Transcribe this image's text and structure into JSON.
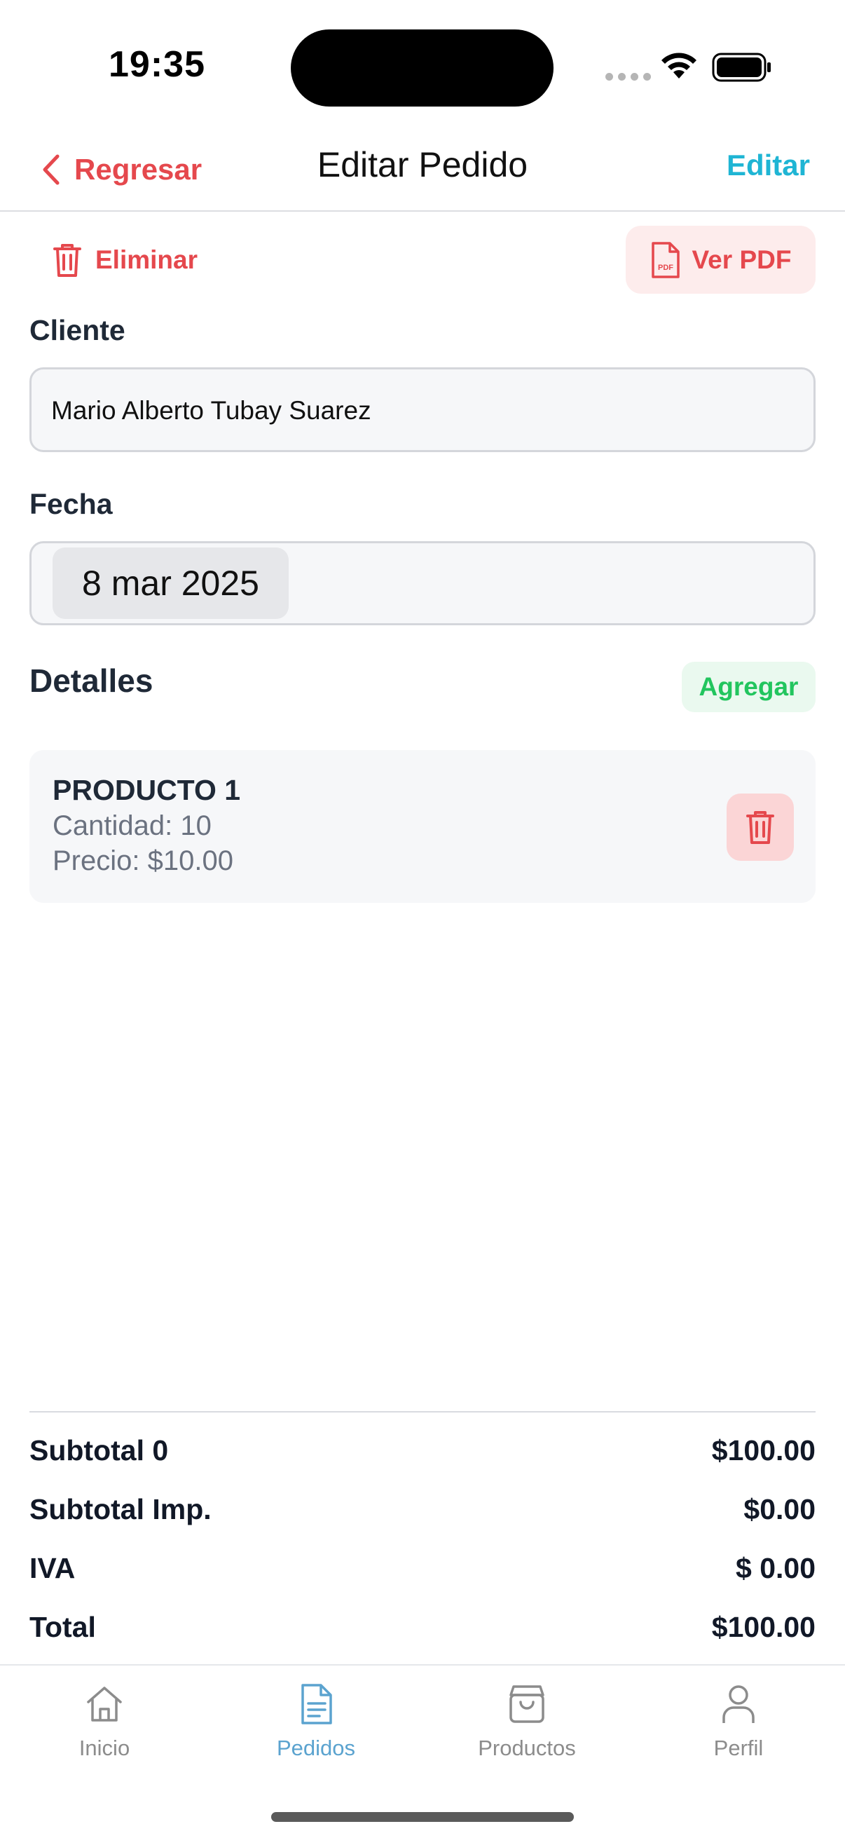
{
  "status_bar": {
    "time": "19:35"
  },
  "header": {
    "back_label": "Regresar",
    "title": "Editar Pedido",
    "edit_label": "Editar"
  },
  "actions": {
    "delete_label": "Eliminar",
    "pdf_label": "Ver PDF"
  },
  "form": {
    "client_label": "Cliente",
    "client_value": "Mario Alberto Tubay Suarez",
    "date_label": "Fecha",
    "date_value": "8 mar 2025"
  },
  "details": {
    "title": "Detalles",
    "add_label": "Agregar",
    "items": [
      {
        "name": "PRODUCTO 1",
        "quantity": "Cantidad: 10",
        "price": "Precio: $10.00"
      }
    ]
  },
  "totals": {
    "rows": [
      {
        "label": "Subtotal 0",
        "value": "$100.00"
      },
      {
        "label": "Subtotal Imp.",
        "value": "$0.00"
      },
      {
        "label": "IVA",
        "value": "$ 0.00"
      },
      {
        "label": "Total",
        "value": "$100.00"
      }
    ]
  },
  "tabbar": {
    "active": "Pedidos",
    "tabs": [
      {
        "label": "Inicio",
        "icon": "home-icon"
      },
      {
        "label": "Pedidos",
        "icon": "document-icon"
      },
      {
        "label": "Productos",
        "icon": "shopping-bag-icon"
      },
      {
        "label": "Perfil",
        "icon": "user-icon"
      }
    ]
  },
  "colors": {
    "danger": "#e5484d",
    "accent": "#1fb5d4",
    "success": "#22c55e",
    "tab_active": "#5ba3cf"
  }
}
